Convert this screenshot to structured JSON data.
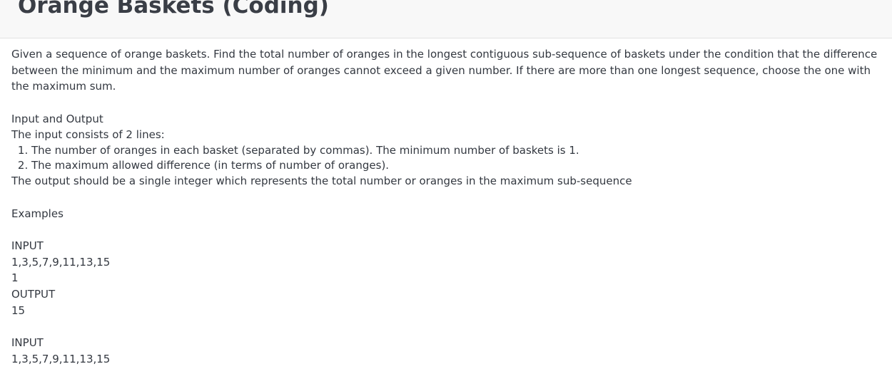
{
  "header": {
    "title": "Orange Baskets (Coding)"
  },
  "problem": {
    "description": "Given a sequence of orange baskets. Find the total number of oranges in the longest contiguous sub-sequence of baskets under the condition that the difference between the minimum and the maximum number of oranges cannot exceed a given number. If there are more than one longest sequence, choose the one with the maximum sum.",
    "io_heading": "Input and Output",
    "input_intro": "The input consists of 2 lines:",
    "input_lines": [
      "The number of oranges in each basket (separated by commas). The minimum number of baskets is 1.",
      "The maximum allowed difference (in terms of number of oranges)."
    ],
    "output_desc": "The output should be a single integer which represents the total number or oranges in the maximum sub-sequence",
    "examples_heading": "Examples",
    "examples": [
      {
        "input_label": "INPUT",
        "input_line1": "1,3,5,7,9,11,13,15",
        "input_line2": "1",
        "output_label": "OUTPUT",
        "output_value": "15"
      },
      {
        "input_label": "INPUT",
        "input_line1": "1,3,5,7,9,11,13,15"
      }
    ]
  }
}
